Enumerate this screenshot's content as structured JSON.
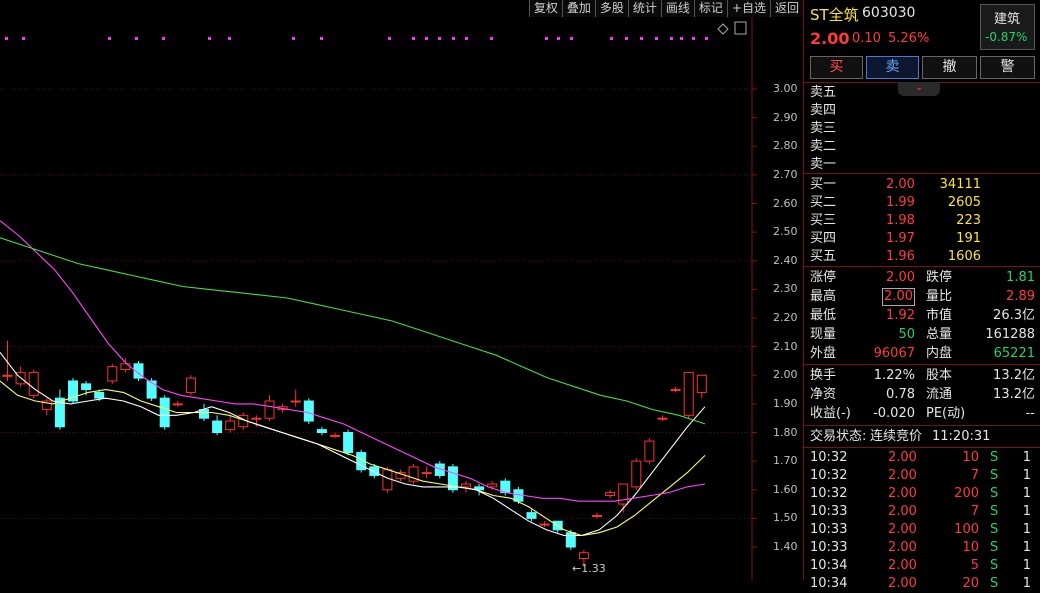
{
  "toolbar": [
    "复权",
    "叠加",
    "多股",
    "统计",
    "画线",
    "标记",
    "+自选",
    "返回"
  ],
  "chart": {
    "y_labels": [
      "3.00",
      "2.90",
      "2.80",
      "2.70",
      "2.60",
      "2.50",
      "2.40",
      "2.30",
      "2.20",
      "2.10",
      "2.00",
      "1.90",
      "1.80",
      "1.70",
      "1.60",
      "1.50",
      "1.40"
    ],
    "min_price_label": "1.33",
    "chart_data": {
      "type": "candlestick",
      "ylim": [
        1.4,
        3.0
      ],
      "candles": [
        [
          2.0,
          2.0,
          2.12,
          1.98
        ],
        [
          1.97,
          2.01,
          2.03,
          1.96
        ],
        [
          1.93,
          2.01,
          2.02,
          1.92
        ],
        [
          1.88,
          1.91,
          1.92,
          1.86
        ],
        [
          1.92,
          1.82,
          1.95,
          1.81
        ],
        [
          1.98,
          1.91,
          1.99,
          1.9
        ],
        [
          1.97,
          1.95,
          1.98,
          1.93
        ],
        [
          1.94,
          1.92,
          1.95,
          1.91
        ],
        [
          1.98,
          2.03,
          2.04,
          1.97
        ],
        [
          2.02,
          2.04,
          2.06,
          2.01
        ],
        [
          2.04,
          1.99,
          2.05,
          1.98
        ],
        [
          1.98,
          1.92,
          1.99,
          1.91
        ],
        [
          1.92,
          1.82,
          1.93,
          1.81
        ],
        [
          1.9,
          1.9,
          1.91,
          1.89
        ],
        [
          1.94,
          1.99,
          2.0,
          1.93
        ],
        [
          1.88,
          1.85,
          1.9,
          1.84
        ],
        [
          1.84,
          1.8,
          1.86,
          1.79
        ],
        [
          1.81,
          1.84,
          1.86,
          1.8
        ],
        [
          1.82,
          1.86,
          1.87,
          1.81
        ],
        [
          1.85,
          1.85,
          1.86,
          1.82
        ],
        [
          1.85,
          1.91,
          1.93,
          1.84
        ],
        [
          1.88,
          1.89,
          1.9,
          1.87
        ],
        [
          1.91,
          1.91,
          1.95,
          1.89
        ],
        [
          1.91,
          1.84,
          1.92,
          1.83
        ],
        [
          1.81,
          1.8,
          1.82,
          1.79
        ],
        [
          1.79,
          1.79,
          1.8,
          1.78
        ],
        [
          1.8,
          1.73,
          1.81,
          1.72
        ],
        [
          1.73,
          1.67,
          1.74,
          1.66
        ],
        [
          1.68,
          1.65,
          1.69,
          1.64
        ],
        [
          1.6,
          1.67,
          1.68,
          1.59
        ],
        [
          1.64,
          1.66,
          1.67,
          1.63
        ],
        [
          1.63,
          1.68,
          1.69,
          1.62
        ],
        [
          1.66,
          1.66,
          1.68,
          1.64
        ],
        [
          1.69,
          1.65,
          1.7,
          1.64
        ],
        [
          1.68,
          1.6,
          1.69,
          1.59
        ],
        [
          1.61,
          1.62,
          1.63,
          1.59
        ],
        [
          1.61,
          1.6,
          1.62,
          1.58
        ],
        [
          1.61,
          1.62,
          1.63,
          1.6
        ],
        [
          1.63,
          1.59,
          1.64,
          1.58
        ],
        [
          1.6,
          1.56,
          1.61,
          1.55
        ],
        [
          1.52,
          1.5,
          1.53,
          1.49
        ],
        [
          1.48,
          1.48,
          1.49,
          1.47
        ],
        [
          1.49,
          1.46,
          1.49,
          1.45
        ],
        [
          1.45,
          1.4,
          1.46,
          1.39
        ],
        [
          1.36,
          1.38,
          1.39,
          1.33
        ],
        [
          1.51,
          1.51,
          1.52,
          1.5
        ],
        [
          1.58,
          1.59,
          1.6,
          1.57
        ],
        [
          1.55,
          1.62,
          1.62,
          1.52
        ],
        [
          1.61,
          1.7,
          1.71,
          1.6
        ],
        [
          1.7,
          1.77,
          1.78,
          1.69
        ],
        [
          1.85,
          1.85,
          1.86,
          1.84
        ],
        [
          1.95,
          1.95,
          1.96,
          1.94
        ],
        [
          1.86,
          2.01,
          2.01,
          1.85
        ],
        [
          1.94,
          2.0,
          2.0,
          1.92
        ]
      ],
      "ma_lines": [
        {
          "color": "#ffff66",
          "values": [
            1.98,
            1.93,
            1.91,
            1.9,
            1.92,
            1.94,
            1.95,
            1.94,
            1.91,
            1.89,
            1.87,
            1.87,
            1.87,
            1.86,
            1.84,
            1.82,
            1.8,
            1.78,
            1.76,
            1.74,
            1.72,
            1.69,
            1.67,
            1.65,
            1.63,
            1.62,
            1.61,
            1.6,
            1.58,
            1.57,
            1.54,
            1.5,
            1.46,
            1.44,
            1.45,
            1.47,
            1.51,
            1.56,
            1.61,
            1.66,
            1.72
          ]
        },
        {
          "color": "#ffffff",
          "values": [
            2.08,
            2.0,
            1.95,
            1.91,
            1.9,
            1.91,
            1.92,
            1.91,
            1.89,
            1.86,
            1.86,
            1.87,
            1.89,
            1.87,
            1.84,
            1.82,
            1.8,
            1.78,
            1.76,
            1.73,
            1.7,
            1.67,
            1.64,
            1.62,
            1.61,
            1.61,
            1.61,
            1.6,
            1.57,
            1.53,
            1.49,
            1.46,
            1.44,
            1.44,
            1.46,
            1.51,
            1.58,
            1.66,
            1.74,
            1.82,
            1.89
          ]
        },
        {
          "color": "#ff44ff",
          "values": [
            2.54,
            2.49,
            2.43,
            2.37,
            2.29,
            2.2,
            2.11,
            2.04,
            1.99,
            1.95,
            1.93,
            1.92,
            1.91,
            1.9,
            1.9,
            1.89,
            1.88,
            1.87,
            1.85,
            1.83,
            1.8,
            1.77,
            1.74,
            1.71,
            1.68,
            1.66,
            1.64,
            1.61,
            1.59,
            1.58,
            1.57,
            1.57,
            1.56,
            1.56,
            1.56,
            1.57,
            1.58,
            1.59,
            1.61,
            1.62
          ]
        },
        {
          "color": "#44dd44",
          "values": [
            2.48,
            2.45,
            2.42,
            2.39,
            2.37,
            2.35,
            2.33,
            2.31,
            2.3,
            2.29,
            2.28,
            2.27,
            2.25,
            2.23,
            2.21,
            2.19,
            2.16,
            2.13,
            2.1,
            2.07,
            2.03,
            1.99,
            1.96,
            1.93,
            1.91,
            1.88,
            1.86,
            1.83
          ]
        }
      ]
    }
  },
  "quote": {
    "name": "ST全筑",
    "code": "603030",
    "price": "2.00",
    "change": "0.10",
    "change_pct": "5.26%",
    "sector": "建筑",
    "sector_pct": "-0.87%",
    "buttons": [
      "买",
      "卖",
      "撤",
      "警"
    ]
  },
  "asks": [
    {
      "label": "卖五",
      "price": "",
      "vol": ""
    },
    {
      "label": "卖四",
      "price": "",
      "vol": ""
    },
    {
      "label": "卖三",
      "price": "",
      "vol": ""
    },
    {
      "label": "卖二",
      "price": "",
      "vol": ""
    },
    {
      "label": "卖一",
      "price": "",
      "vol": ""
    }
  ],
  "bids": [
    {
      "label": "买一",
      "price": "2.00",
      "vol": "34111"
    },
    {
      "label": "买二",
      "price": "1.99",
      "vol": "2605"
    },
    {
      "label": "买三",
      "price": "1.98",
      "vol": "223"
    },
    {
      "label": "买四",
      "price": "1.97",
      "vol": "191"
    },
    {
      "label": "买五",
      "price": "1.96",
      "vol": "1606"
    }
  ],
  "stats": [
    {
      "l1": "涨停",
      "v1": "2.00",
      "c1": "red",
      "l2": "跌停",
      "v2": "1.81",
      "c2": "green"
    },
    {
      "l1": "最高",
      "v1": "2.00",
      "c1": "red",
      "l2": "量比",
      "v2": "2.89",
      "c2": "red"
    },
    {
      "l1": "最低",
      "v1": "1.92",
      "c1": "red",
      "l2": "市值",
      "v2": "26.3亿",
      "c2": "white"
    },
    {
      "l1": "现量",
      "v1": "50",
      "c1": "green",
      "l2": "总量",
      "v2": "161288",
      "c2": "white"
    },
    {
      "l1": "外盘",
      "v1": "96067",
      "c1": "red",
      "l2": "内盘",
      "v2": "65221",
      "c2": "green"
    }
  ],
  "stats2": [
    {
      "l1": "换手",
      "v1": "1.22%",
      "l2": "股本",
      "v2": "13.2亿"
    },
    {
      "l1": "净资",
      "v1": "0.78",
      "l2": "流通",
      "v2": "13.2亿"
    },
    {
      "l1": "收益(-)",
      "v1": "-0.020",
      "l2": "PE(动)",
      "v2": "--"
    }
  ],
  "status": {
    "label": "交易状态:",
    "value": "连续竞价",
    "time": "11:20:31"
  },
  "ticks": [
    {
      "time": "10:32",
      "price": "2.00",
      "vol": "10",
      "side": "S",
      "n": "1"
    },
    {
      "time": "10:32",
      "price": "2.00",
      "vol": "7",
      "side": "S",
      "n": "1"
    },
    {
      "time": "10:32",
      "price": "2.00",
      "vol": "200",
      "side": "S",
      "n": "1"
    },
    {
      "time": "10:33",
      "price": "2.00",
      "vol": "7",
      "side": "S",
      "n": "1"
    },
    {
      "time": "10:33",
      "price": "2.00",
      "vol": "100",
      "side": "S",
      "n": "1"
    },
    {
      "time": "10:33",
      "price": "2.00",
      "vol": "10",
      "side": "S",
      "n": "1"
    },
    {
      "time": "10:34",
      "price": "2.00",
      "vol": "5",
      "side": "S",
      "n": "1"
    },
    {
      "time": "10:34",
      "price": "2.00",
      "vol": "20",
      "side": "S",
      "n": "1"
    }
  ]
}
